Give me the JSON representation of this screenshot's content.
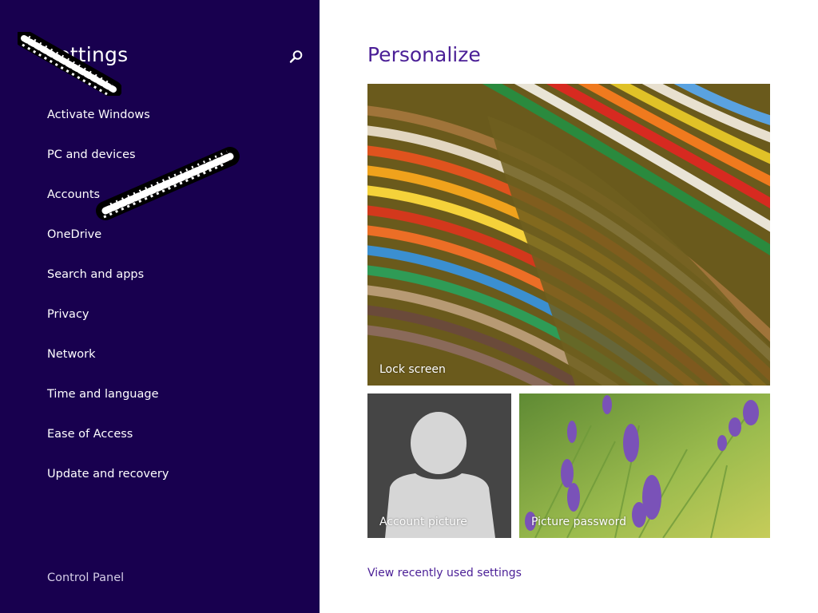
{
  "sidebar": {
    "title": "settings",
    "items": [
      {
        "label": "Activate Windows"
      },
      {
        "label": "PC and devices"
      },
      {
        "label": "Accounts"
      },
      {
        "label": "OneDrive"
      },
      {
        "label": "Search and apps"
      },
      {
        "label": "Privacy"
      },
      {
        "label": "Network"
      },
      {
        "label": "Time and language"
      },
      {
        "label": "Ease of Access"
      },
      {
        "label": "Update and recovery"
      }
    ],
    "control_panel": "Control Panel",
    "search_icon": "search-icon"
  },
  "main": {
    "title": "Personalize",
    "tiles": {
      "lock_screen": "Lock screen",
      "account_picture": "Account picture",
      "picture_password": "Picture password"
    },
    "view_recent": "View recently used settings"
  },
  "colors": {
    "sidebar_bg": "#18004f",
    "accent": "#4a1e96",
    "text_on_dark": "#ffffff"
  }
}
